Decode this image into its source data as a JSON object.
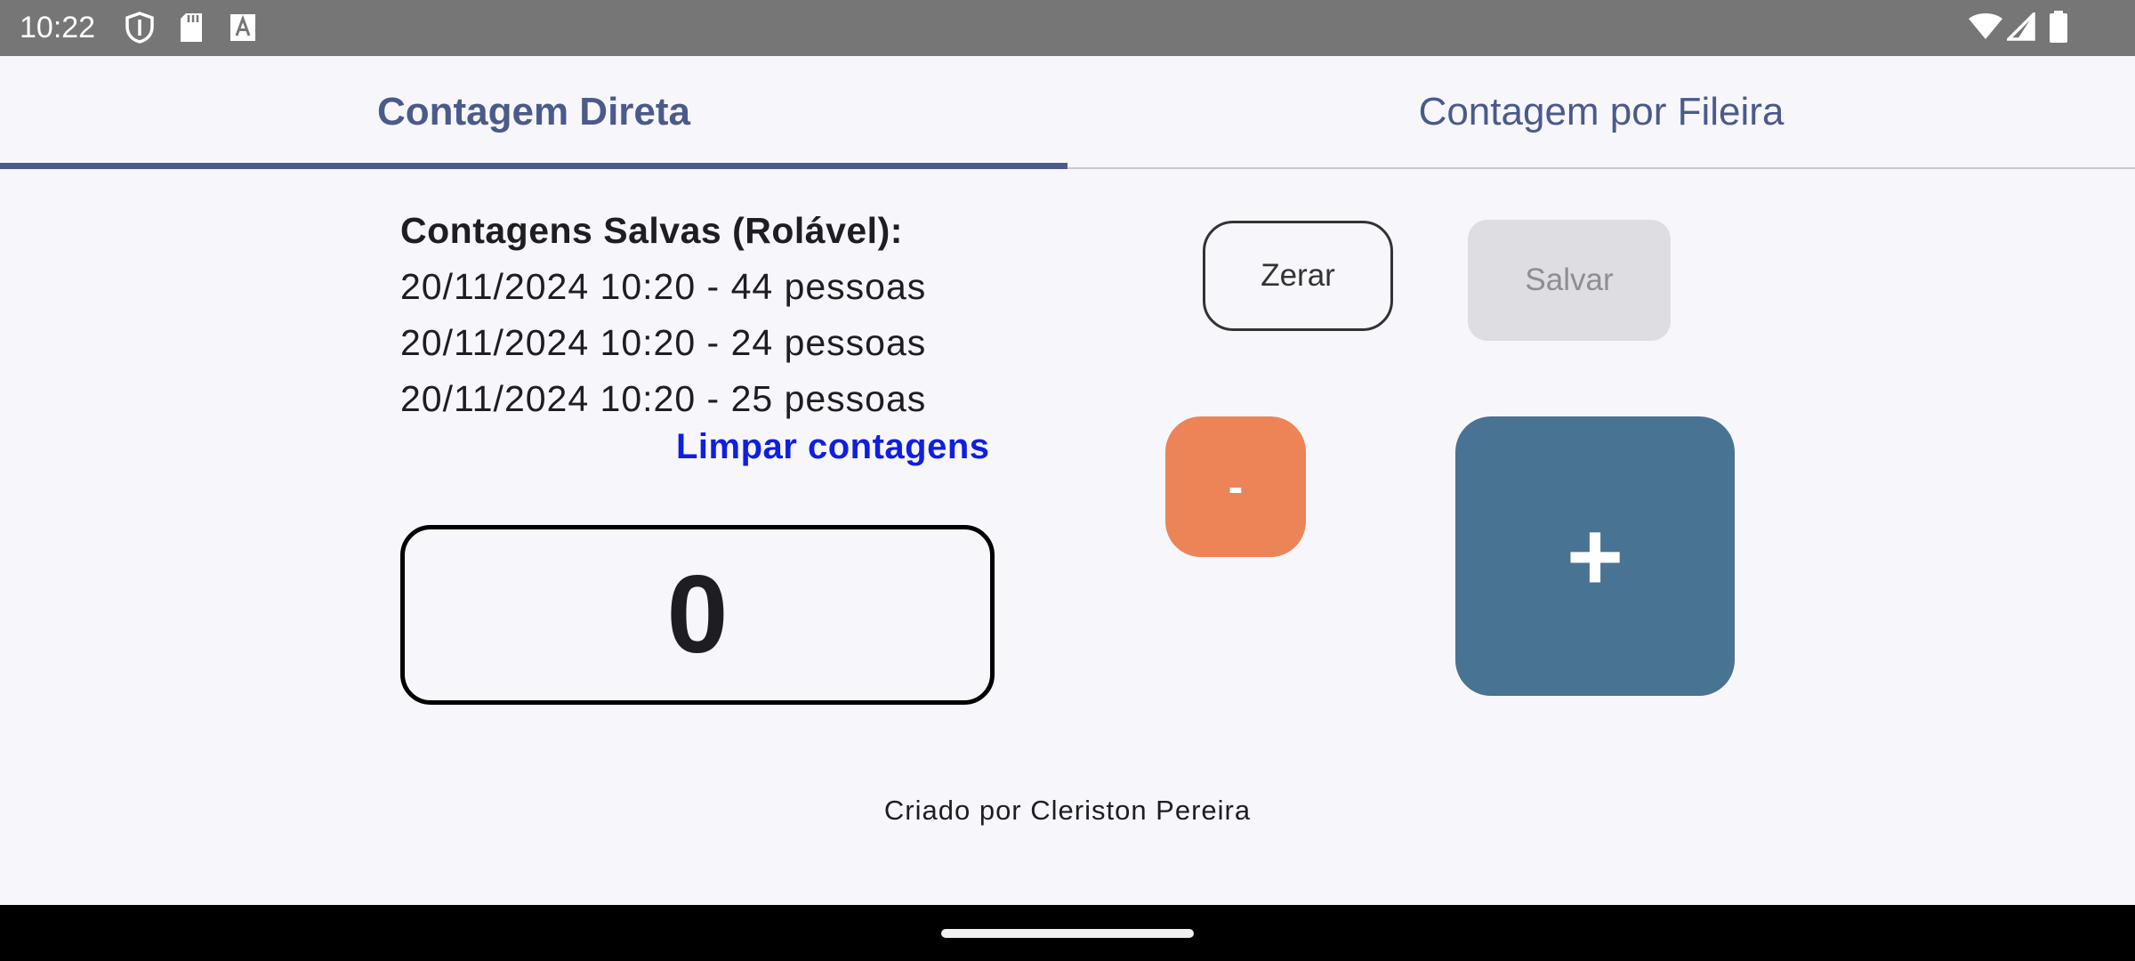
{
  "status_bar": {
    "time": "10:22",
    "left_icons": [
      "shield-icon",
      "sd-card-icon",
      "font-a-icon"
    ],
    "right_icons": [
      "wifi-icon",
      "signal-icon",
      "battery-icon"
    ]
  },
  "tabs": [
    {
      "label": "Contagem Direta",
      "active": true
    },
    {
      "label": "Contagem por Fileira",
      "active": false
    }
  ],
  "saved_counts": {
    "title": "Contagens Salvas (Rolável):",
    "items": [
      "20/11/2024 10:20 - 44 pessoas",
      "20/11/2024 10:20 - 24 pessoas",
      "20/11/2024 10:20 - 25 pessoas"
    ],
    "clear_label": "Limpar contagens"
  },
  "counter": {
    "value": "0"
  },
  "buttons": {
    "reset_label": "Zerar",
    "save_label": "Salvar",
    "save_enabled": false,
    "minus_label": "-",
    "plus_label": "+"
  },
  "footer": {
    "credit": "Criado por Cleriston Pereira"
  },
  "colors": {
    "tab_accent": "#4a5a8a",
    "link": "#0f1fe0",
    "minus_button": "#ec8458",
    "plus_button": "#487392",
    "disabled_button": "#dedde2"
  }
}
